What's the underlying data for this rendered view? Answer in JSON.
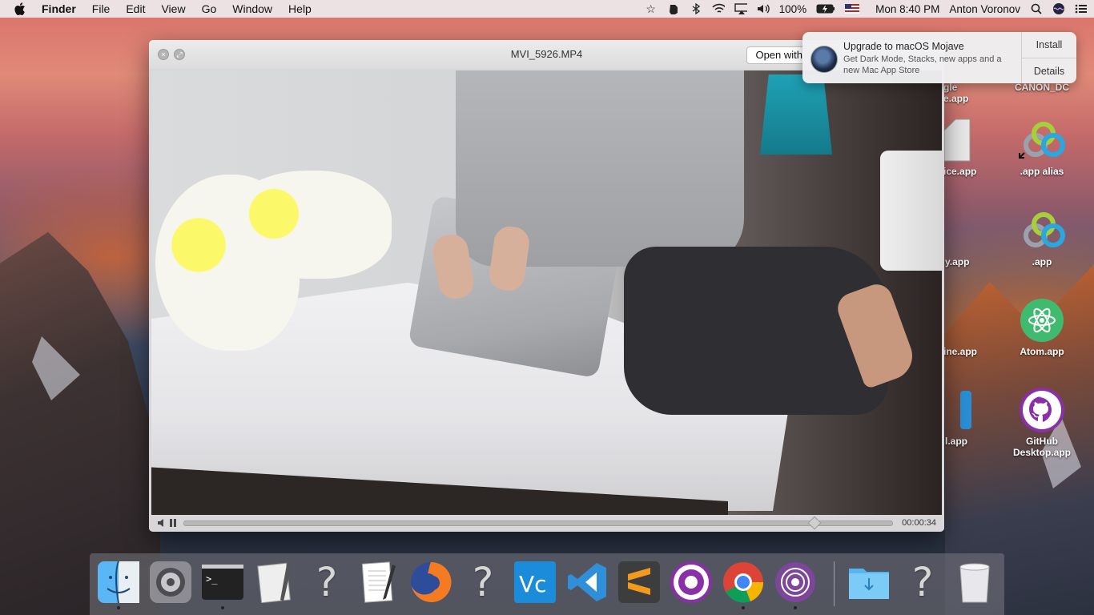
{
  "menubar": {
    "app_name": "Finder",
    "menus": [
      "File",
      "Edit",
      "View",
      "Go",
      "Window",
      "Help"
    ],
    "battery": "100%",
    "clock": "Mon 8:40 PM",
    "user": "Anton Voronov"
  },
  "video_window": {
    "title": "MVI_5926.MP4",
    "open_with_label": "Open with",
    "elapsed_time": "00:00:34",
    "playback_progress": 0.888
  },
  "notification": {
    "title": "Upgrade to macOS Mojave",
    "body": "Get Dark Mode, Stacks, new apps and a new Mac App Store",
    "install_label": "Install",
    "details_label": "Details"
  },
  "desktop_icons": [
    {
      "label": "gle\ne.app"
    },
    {
      "label": "CANON_DC"
    },
    {
      "label": "ice.app"
    },
    {
      "label": ".app alias"
    },
    {
      "label": "y.app"
    },
    {
      "label": ".app"
    },
    {
      "label": "ine.app"
    },
    {
      "label": "Atom.app"
    },
    {
      "label": "l.app"
    },
    {
      "label": "GitHub\nDesktop.app"
    }
  ],
  "dock": [
    {
      "name": "finder-icon",
      "running": true
    },
    {
      "name": "system-preferences-icon",
      "running": false
    },
    {
      "name": "terminal-icon",
      "running": true
    },
    {
      "name": "script-editor-icon",
      "running": false
    },
    {
      "name": "unknown-app-icon",
      "running": false
    },
    {
      "name": "textedit-icon",
      "running": false
    },
    {
      "name": "firefox-icon",
      "running": false
    },
    {
      "name": "unknown-app-icon",
      "running": false
    },
    {
      "name": "vnc-icon",
      "running": false
    },
    {
      "name": "vscode-icon",
      "running": false
    },
    {
      "name": "sublime-text-icon",
      "running": false
    },
    {
      "name": "github-desktop-icon",
      "running": false
    },
    {
      "name": "chrome-icon",
      "running": true
    },
    {
      "name": "tor-browser-icon",
      "running": true
    },
    {
      "name": "downloads-folder-icon",
      "running": false
    },
    {
      "name": "unknown-app-icon",
      "running": false
    },
    {
      "name": "trash-icon",
      "running": false
    }
  ]
}
